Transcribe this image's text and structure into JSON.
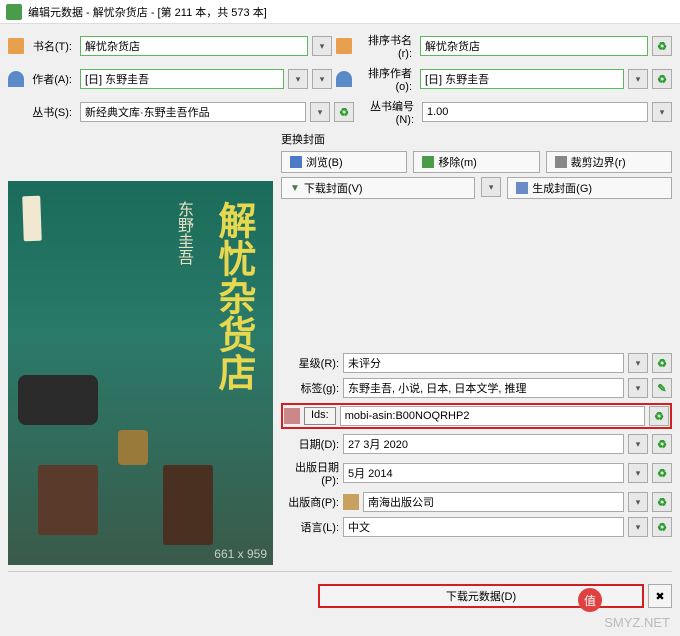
{
  "window": {
    "title": "编辑元数据 - 解忧杂货店 - [第 211 本，共 573 本]"
  },
  "fields": {
    "title_label": "书名(T):",
    "title": "解忧杂货店",
    "sort_title_label": "排序书名(r):",
    "sort_title": "解忧杂货店",
    "author_label": "作者(A):",
    "author": "[日] 东野圭吾",
    "sort_author_label": "排序作者(o):",
    "sort_author": "[日] 东野圭吾",
    "series_label": "丛书(S):",
    "series": "新经典文库·东野圭吾作品",
    "series_num_label": "丛书编号(N):",
    "series_num": "1.00"
  },
  "cover_ops": {
    "section": "更换封面",
    "browse": "浏览(B)",
    "trim": "移除(m)",
    "crop": "裁剪边界(r)",
    "download": "下载封面(V)",
    "generate": "生成封面(G)"
  },
  "meta": {
    "rating_label": "星级(R):",
    "rating": "未评分",
    "tags_label": "标签(g):",
    "tags": "东野圭吾, 小说, 日本, 日本文学, 推理",
    "ids_label": "Ids:",
    "ids": "mobi-asin:B00NOQRHP2",
    "date_label": "日期(D):",
    "date": "27 3月 2020",
    "pubdate_label": "出版日期(P):",
    "pubdate": "5月 2014",
    "publisher_label": "出版商(P):",
    "publisher": "南海出版公司",
    "language_label": "语言(L):",
    "language": "中文"
  },
  "cover": {
    "title_text": "解忧杂货店",
    "author_text": "东野圭吾",
    "dim": "661 x 959"
  },
  "footer": {
    "download_meta": "下载元数据(D)"
  },
  "watermark": "SMYZ.NET",
  "badge": "值"
}
